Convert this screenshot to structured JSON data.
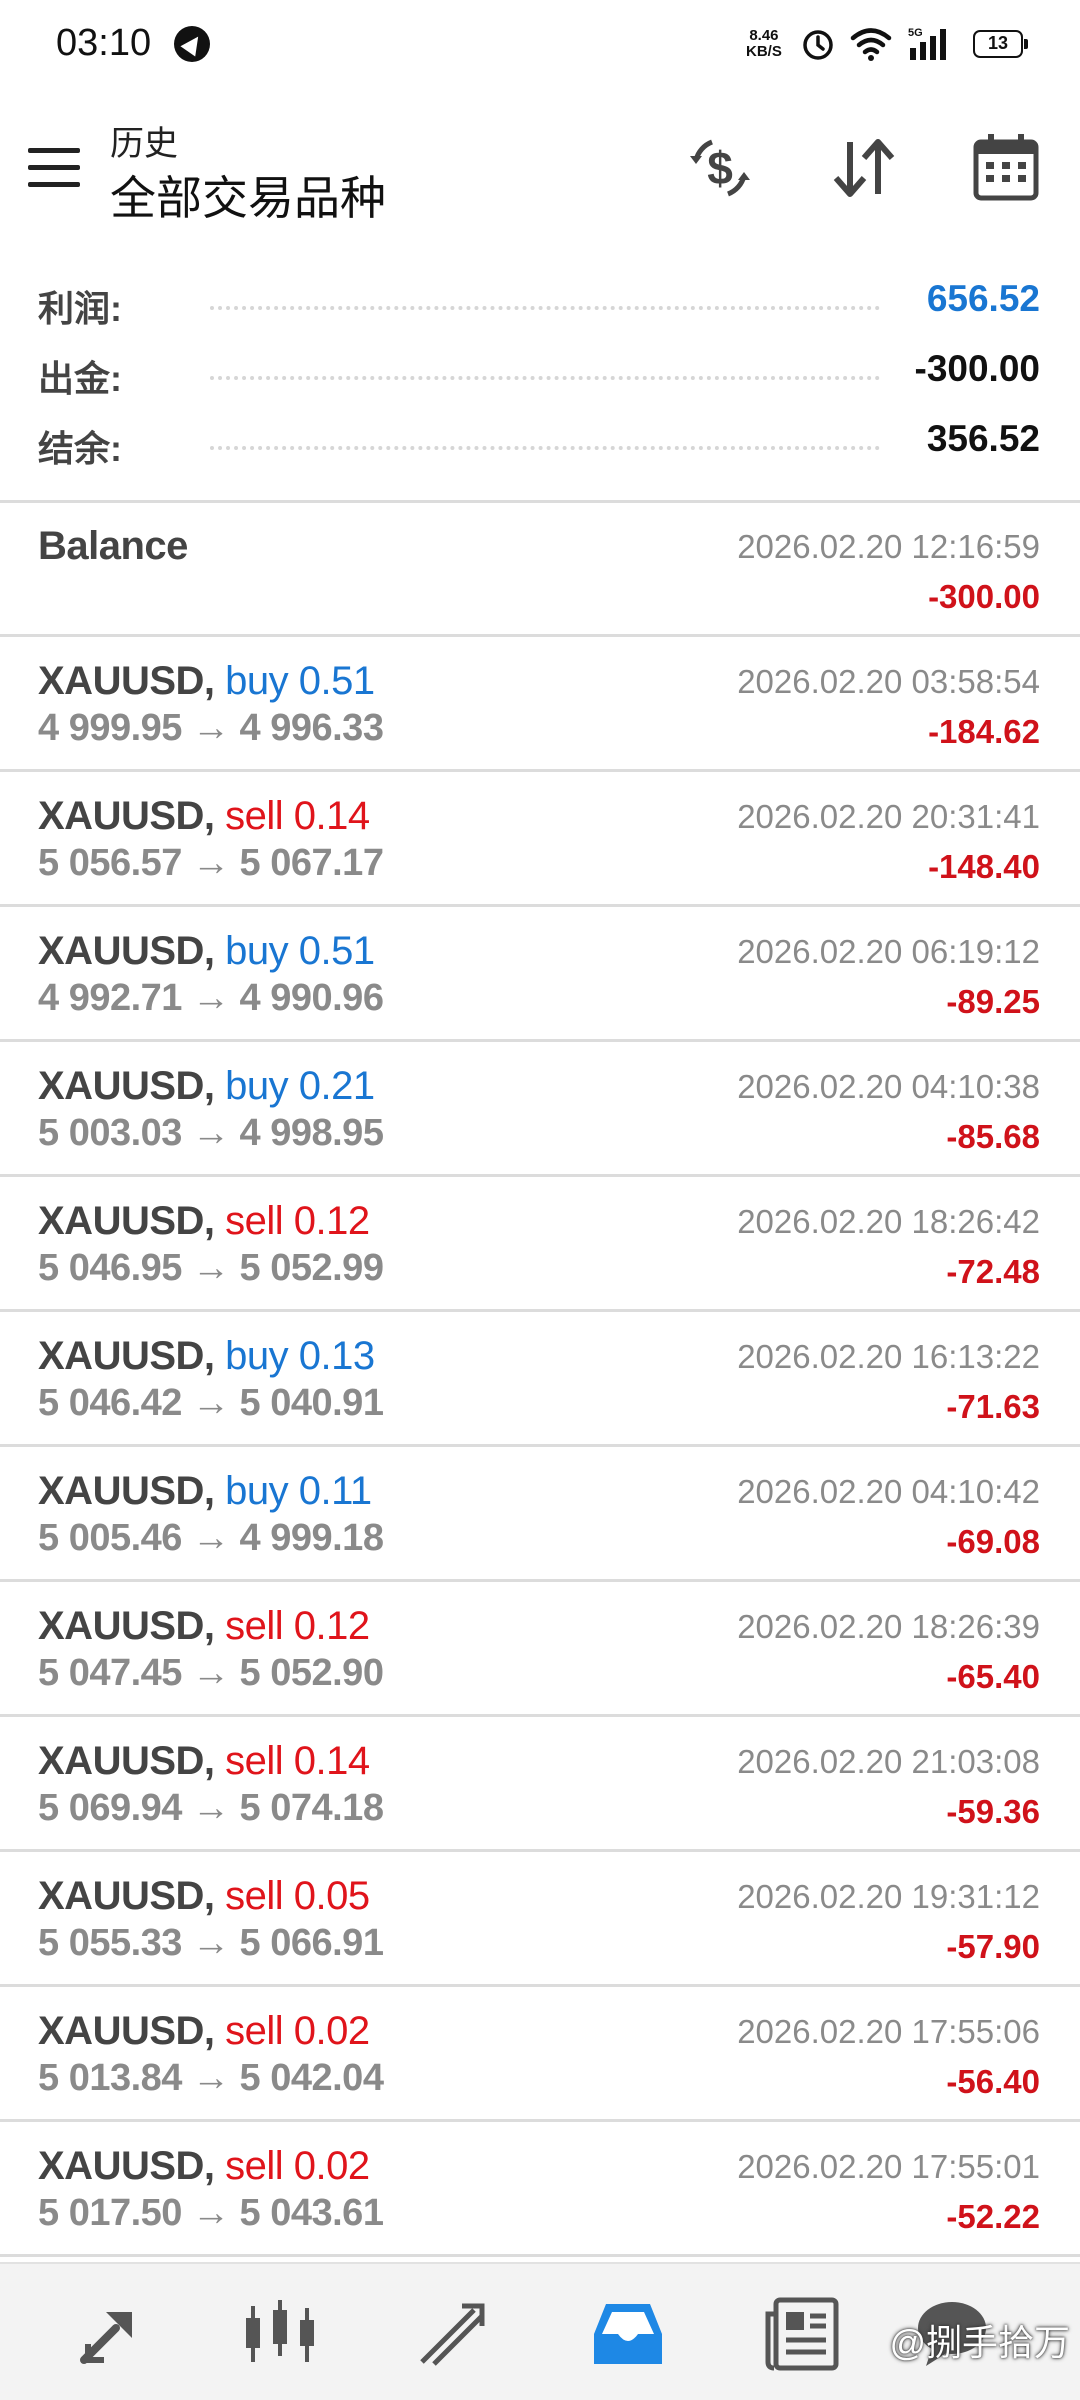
{
  "status_bar": {
    "time": "03:10",
    "net_speed_value": "8.46",
    "net_speed_unit": "KB/S",
    "battery": "13"
  },
  "header": {
    "subtitle": "历史",
    "title": "全部交易品种",
    "icons": [
      "menu-icon",
      "currency-exchange-icon",
      "sort-icon",
      "calendar-icon"
    ]
  },
  "summary": {
    "profit_label": "利润:",
    "profit_value": "656.52",
    "withdraw_label": "出金:",
    "withdraw_value": "-300.00",
    "balance_label": "结余:",
    "balance_value": "356.52"
  },
  "balance_entry": {
    "label": "Balance",
    "time": "2026.02.20 12:16:59",
    "amount": "-300.00"
  },
  "trades": [
    {
      "symbol": "XAUUSD,",
      "side": "buy",
      "dir_label": "buy 0.51",
      "prices": "4 999.95 → 4 996.33",
      "time": "2026.02.20 03:58:54",
      "profit": "-184.62"
    },
    {
      "symbol": "XAUUSD,",
      "side": "sell",
      "dir_label": "sell 0.14",
      "prices": "5 056.57 → 5 067.17",
      "time": "2026.02.20 20:31:41",
      "profit": "-148.40"
    },
    {
      "symbol": "XAUUSD,",
      "side": "buy",
      "dir_label": "buy 0.51",
      "prices": "4 992.71 → 4 990.96",
      "time": "2026.02.20 06:19:12",
      "profit": "-89.25"
    },
    {
      "symbol": "XAUUSD,",
      "side": "buy",
      "dir_label": "buy 0.21",
      "prices": "5 003.03 → 4 998.95",
      "time": "2026.02.20 04:10:38",
      "profit": "-85.68"
    },
    {
      "symbol": "XAUUSD,",
      "side": "sell",
      "dir_label": "sell 0.12",
      "prices": "5 046.95 → 5 052.99",
      "time": "2026.02.20 18:26:42",
      "profit": "-72.48"
    },
    {
      "symbol": "XAUUSD,",
      "side": "buy",
      "dir_label": "buy 0.13",
      "prices": "5 046.42 → 5 040.91",
      "time": "2026.02.20 16:13:22",
      "profit": "-71.63"
    },
    {
      "symbol": "XAUUSD,",
      "side": "buy",
      "dir_label": "buy 0.11",
      "prices": "5 005.46 → 4 999.18",
      "time": "2026.02.20 04:10:42",
      "profit": "-69.08"
    },
    {
      "symbol": "XAUUSD,",
      "side": "sell",
      "dir_label": "sell 0.12",
      "prices": "5 047.45 → 5 052.90",
      "time": "2026.02.20 18:26:39",
      "profit": "-65.40"
    },
    {
      "symbol": "XAUUSD,",
      "side": "sell",
      "dir_label": "sell 0.14",
      "prices": "5 069.94 → 5 074.18",
      "time": "2026.02.20 21:03:08",
      "profit": "-59.36"
    },
    {
      "symbol": "XAUUSD,",
      "side": "sell",
      "dir_label": "sell 0.05",
      "prices": "5 055.33 → 5 066.91",
      "time": "2026.02.20 19:31:12",
      "profit": "-57.90"
    },
    {
      "symbol": "XAUUSD,",
      "side": "sell",
      "dir_label": "sell 0.02",
      "prices": "5 013.84 → 5 042.04",
      "time": "2026.02.20 17:55:06",
      "profit": "-56.40"
    },
    {
      "symbol": "XAUUSD,",
      "side": "sell",
      "dir_label": "sell 0.02",
      "prices": "5 017.50 → 5 043.61",
      "time": "2026.02.20 17:55:01",
      "profit": "-52.22"
    }
  ],
  "bottom_nav": {
    "items": [
      "quotes-icon",
      "chart-icon",
      "trade-icon",
      "history-icon",
      "news-icon",
      "chat-icon"
    ],
    "active": "history-icon",
    "watermark": "@捌手拾万"
  },
  "colors": {
    "buy": "#1976d2",
    "sell": "#e0141b",
    "profit_positive": "#1976d2",
    "loss": "#d0121a"
  }
}
